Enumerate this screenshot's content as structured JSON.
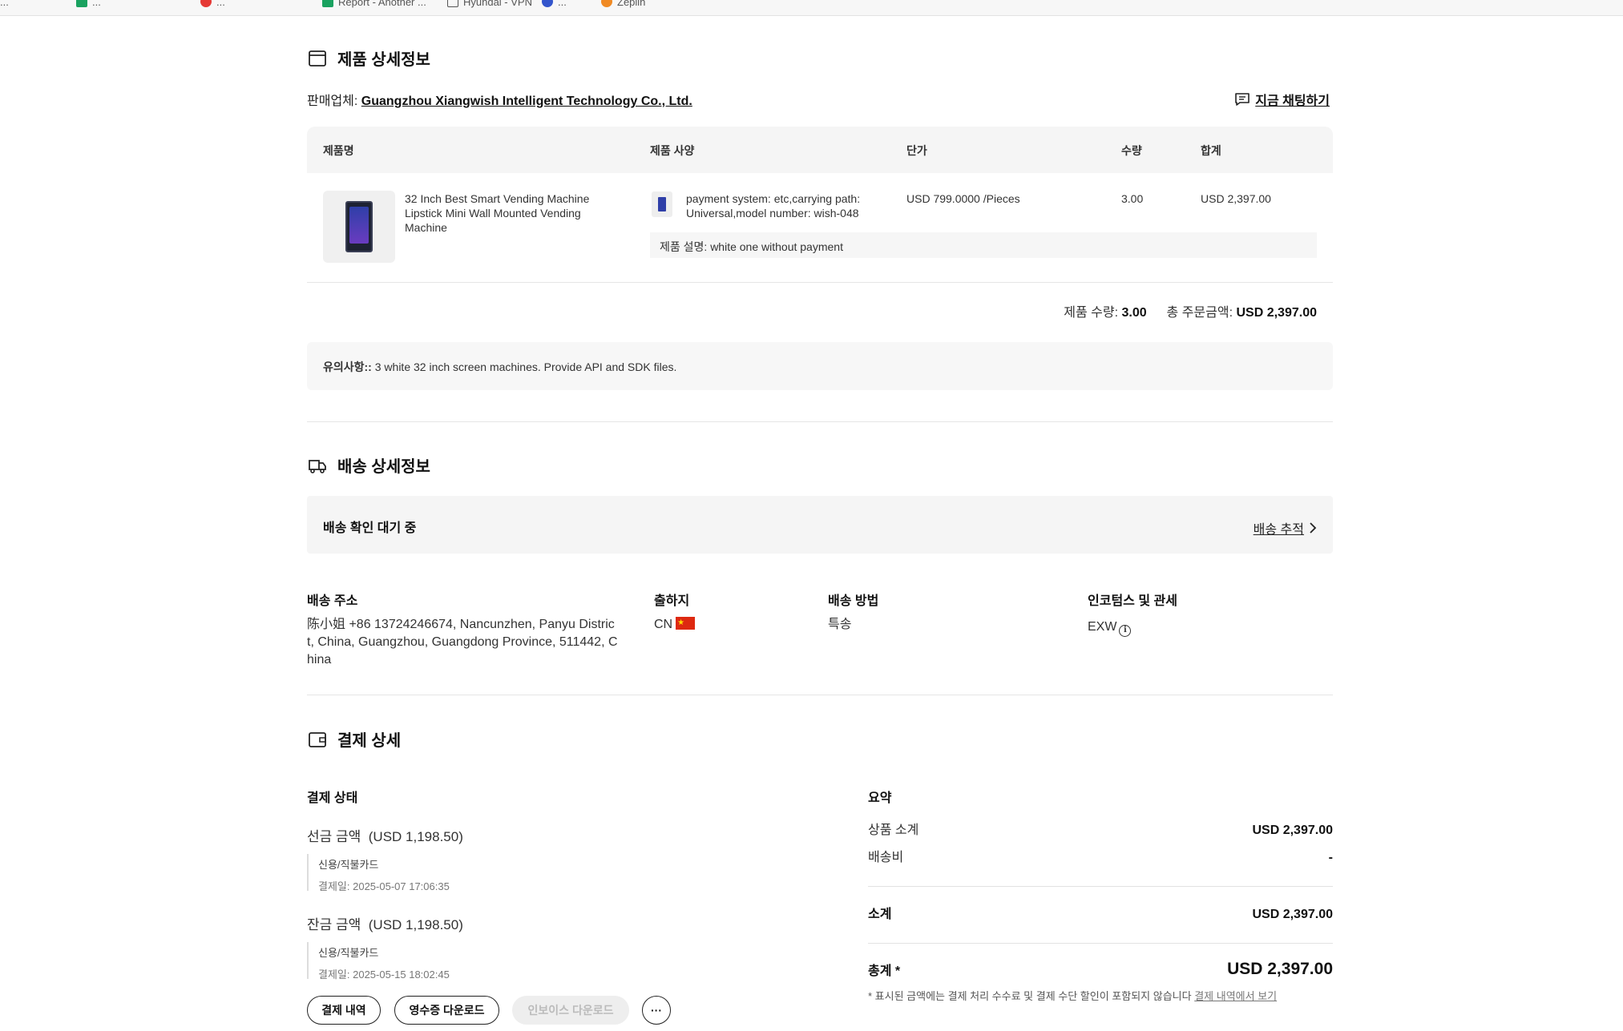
{
  "bookmarks": [
    {
      "label": "...",
      "color": "#888888"
    },
    {
      "label": "...",
      "color": "#1aa260"
    },
    {
      "label": "...",
      "color": "#e53935"
    },
    {
      "label": "Report - Another ...",
      "color": "#1aa260"
    },
    {
      "label": "Hyundai - VPN",
      "color": "#555555"
    },
    {
      "label": "...",
      "color": "#3355cc"
    },
    {
      "label": "Zeplin",
      "color": "#f08a24"
    }
  ],
  "product": {
    "title": "제품 상세정보",
    "seller_label": "판매업체:",
    "seller_name": "Guangzhou Xiangwish Intelligent Technology Co., Ltd.",
    "chat_label": "지금 채팅하기",
    "columns": [
      "제품명",
      "제품 사양",
      "단가",
      "수량",
      "합계"
    ],
    "item": {
      "name_line1": "32 Inch Best Smart Vending Machine",
      "name_line2": "Lipstick Mini Wall Mounted Vending",
      "name_line3": "Machine",
      "spec_line1": "payment system: etc,carrying path:",
      "spec_line2": "Universal,model number: wish-048",
      "unit_price": "USD 799.0000 /Pieces",
      "quantity": "3.00",
      "total": "USD 2,397.00",
      "description": "제품 설명: white one without payment"
    },
    "summary_qty_label": "제품 수량:",
    "summary_qty_value": "3.00",
    "summary_total_label": "총 주문금액:",
    "summary_total_value": "USD 2,397.00",
    "note_label": "유의사항::",
    "note_text": "3 white 32 inch screen machines. Provide API and SDK files."
  },
  "shipping": {
    "title": "배송 상세정보",
    "status": "배송 확인 대기 중",
    "track_label": "배송 추적",
    "address_label": "배송 주소",
    "address_line1": "陈小姐 +86 13724246674, Nancunzhen, Panyu Distric",
    "address_line2": "t, China, Guangzhou, Guangdong Province, 511442, C",
    "address_line3": "hina",
    "origin_label": "출하지",
    "origin_value": "CN",
    "method_label": "배송 방법",
    "method_value": "특송",
    "incoterms_label": "인코텀스 및 관세",
    "incoterms_value": "EXW"
  },
  "payment": {
    "title": "결제 상세",
    "status_label": "결제 상태",
    "deposit_label": "선금 금액",
    "deposit_amount": "(USD 1,198.50)",
    "deposit_method": "신용/직불카드",
    "deposit_date": "결제일: 2025-05-07 17:06:35",
    "balance_label": "잔금 금액",
    "balance_amount": "(USD 1,198.50)",
    "balance_method": "신용/직불카드",
    "balance_date": "결제일: 2025-05-15 18:02:45",
    "summary_label": "요약",
    "subtotal_goods_label": "상품 소계",
    "subtotal_goods_value": "USD 2,397.00",
    "shipping_fee_label": "배송비",
    "shipping_fee_value": "-",
    "subtotal_label": "소계",
    "subtotal_value": "USD 2,397.00",
    "grand_total_label": "총계 *",
    "grand_total_value": "USD 2,397.00",
    "footnote": "* 표시된 금액에는 결제 처리 수수료 및 결제 수단 할인이 포함되지 않습니다",
    "footnote_link": "결제 내역에서 보기",
    "buttons": {
      "history": "결제 내역",
      "receipt": "영수증 다운로드",
      "invoice": "인보이스 다운로드",
      "more": "···"
    }
  }
}
